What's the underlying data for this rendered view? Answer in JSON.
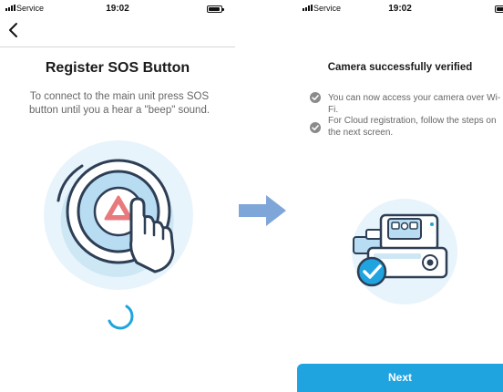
{
  "left_screen": {
    "status_bar": {
      "carrier": "Service",
      "time": "19:02"
    },
    "title": "Register SOS Button",
    "instruction": "To connect to the main unit press SOS button until you a hear a \"beep\" sound."
  },
  "right_screen": {
    "status_bar": {
      "carrier": "Service",
      "time": "19:02"
    },
    "title": "Camera successfully verified",
    "items": [
      "You can now access your camera over Wi-Fi.",
      "For Cloud registration, follow the steps on the next screen."
    ],
    "next_label": "Next"
  },
  "colors": {
    "accent": "#1fa4e0",
    "arrow": "#7fa6d8",
    "illustration_bg": "#e8f4fb",
    "alert": "#e87a7e"
  },
  "icons": {
    "back": "chevron-left-icon",
    "check": "check-circle-icon",
    "arrow": "arrow-right-icon",
    "spinner": "loading-spinner-icon"
  }
}
